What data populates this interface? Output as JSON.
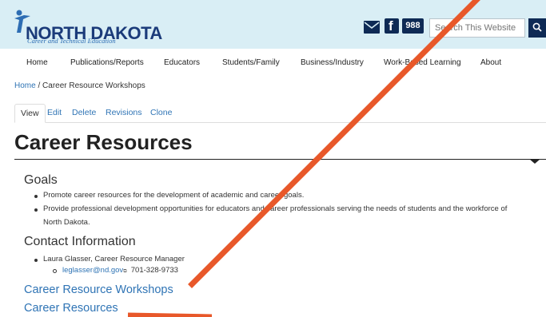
{
  "colors": {
    "header_bg": "#d9eef5",
    "brand_navy": "#0e2a55",
    "link_blue": "#2f74b5",
    "annotation_orange": "#e8582a"
  },
  "header": {
    "logo_title": "NORTH DAKOTA",
    "logo_subtitle": "Career and Technical Education",
    "icons": [
      "mail-icon",
      "facebook-icon"
    ],
    "badge": "988",
    "search_placeholder": "Search This Website",
    "search_button_icon": "search-icon"
  },
  "nav": {
    "items": [
      "Home",
      "Publications/Reports",
      "Educators",
      "Students/Family",
      "Business/Industry",
      "Work-Based Learning",
      "About"
    ]
  },
  "breadcrumb": {
    "home": "Home",
    "separator": "/",
    "current": "Career Resource Workshops"
  },
  "tabs": [
    "View",
    "Edit",
    "Delete",
    "Revisions",
    "Clone"
  ],
  "page_title": "Career Resources",
  "goals": {
    "heading": "Goals",
    "items": [
      "Promote career resources for the development of academic and career goals.",
      "Provide professional development opportunities for educators and career professionals serving the needs of students and the workforce of",
      "North Dakota."
    ]
  },
  "contact": {
    "heading": "Contact Information",
    "person": "Laura Glasser, Career Resource Manager",
    "email": "leglasser@nd.gov",
    "email_ext_marker": "⧉",
    "phone": "701-328-9733"
  },
  "links": {
    "workshops": "Career Resource Workshops",
    "resources": "Career Resources"
  }
}
